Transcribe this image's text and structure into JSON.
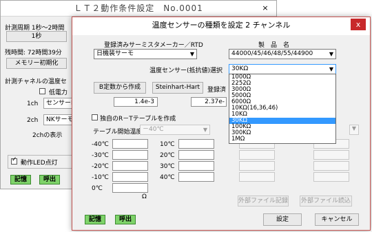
{
  "back_window": {
    "title": "ＬＴ２動作条件設定　No.0001",
    "close": "×",
    "interval_label": "計測周期 1秒～2時間",
    "interval_value": "1秒",
    "remaining_label": "残時間: 72時間39分",
    "memory_init": "メモリー初期化",
    "channel_label": "計測チャネルの温度セ",
    "low_power": "低電力",
    "ch1_label": "1ch",
    "ch1_value": "センサーR-T",
    "ch2_label": "2ch",
    "ch2_value": "NKサーモ30",
    "ch2_display": "2chの表示",
    "led_label": "動作LED点灯",
    "save": "記憶",
    "call": "呼出"
  },
  "dialog": {
    "title": "温度センサーの種類を設定 2 チャンネル",
    "close": "x",
    "maker_label": "登録済みサーミスタメーカー／RTD",
    "maker_value": "日機装サーモ",
    "product_label": "製　品　名",
    "product_value": "44000/45/46/48/55/44900",
    "sensor_type_label": "温度センサー(抵抗値)選択",
    "sensor_type_value": "30KΩ",
    "b_constant_btn": "B定数から作成",
    "steinhart_btn": "Steinhart-Hart",
    "registered_btn": "登録済",
    "coef1": "1.4e-3",
    "coef2": "2.37e-",
    "own_table_label": "独自のR－Tテーブルを作成",
    "table_start_label": "テーブル開始温度",
    "table_start_value": "－40℃",
    "temps_left": [
      "-40℃",
      "-30℃",
      "-20℃",
      "-10℃",
      "0℃"
    ],
    "temps_right": [
      "10℃",
      "20℃",
      "30℃",
      "40℃"
    ],
    "ohm_unit": "Ω",
    "ext_save": "外部ファイル記録",
    "ext_load": "外部ファイル読込",
    "save": "記憶",
    "call": "呼出",
    "set_btn": "設定",
    "cancel_btn": "キャンセル",
    "options": [
      "1000Ω",
      "2252Ω",
      "3000Ω",
      "5000Ω",
      "6000Ω",
      "10KΩ(16,36,46)",
      "10KΩ",
      "30KΩ",
      "100KΩ",
      "300KΩ",
      "1MΩ"
    ],
    "selected_option": "30KΩ"
  },
  "colors": {
    "selection": "#3399ff",
    "close_red": "#c8292b",
    "green": "#7fd36a"
  }
}
